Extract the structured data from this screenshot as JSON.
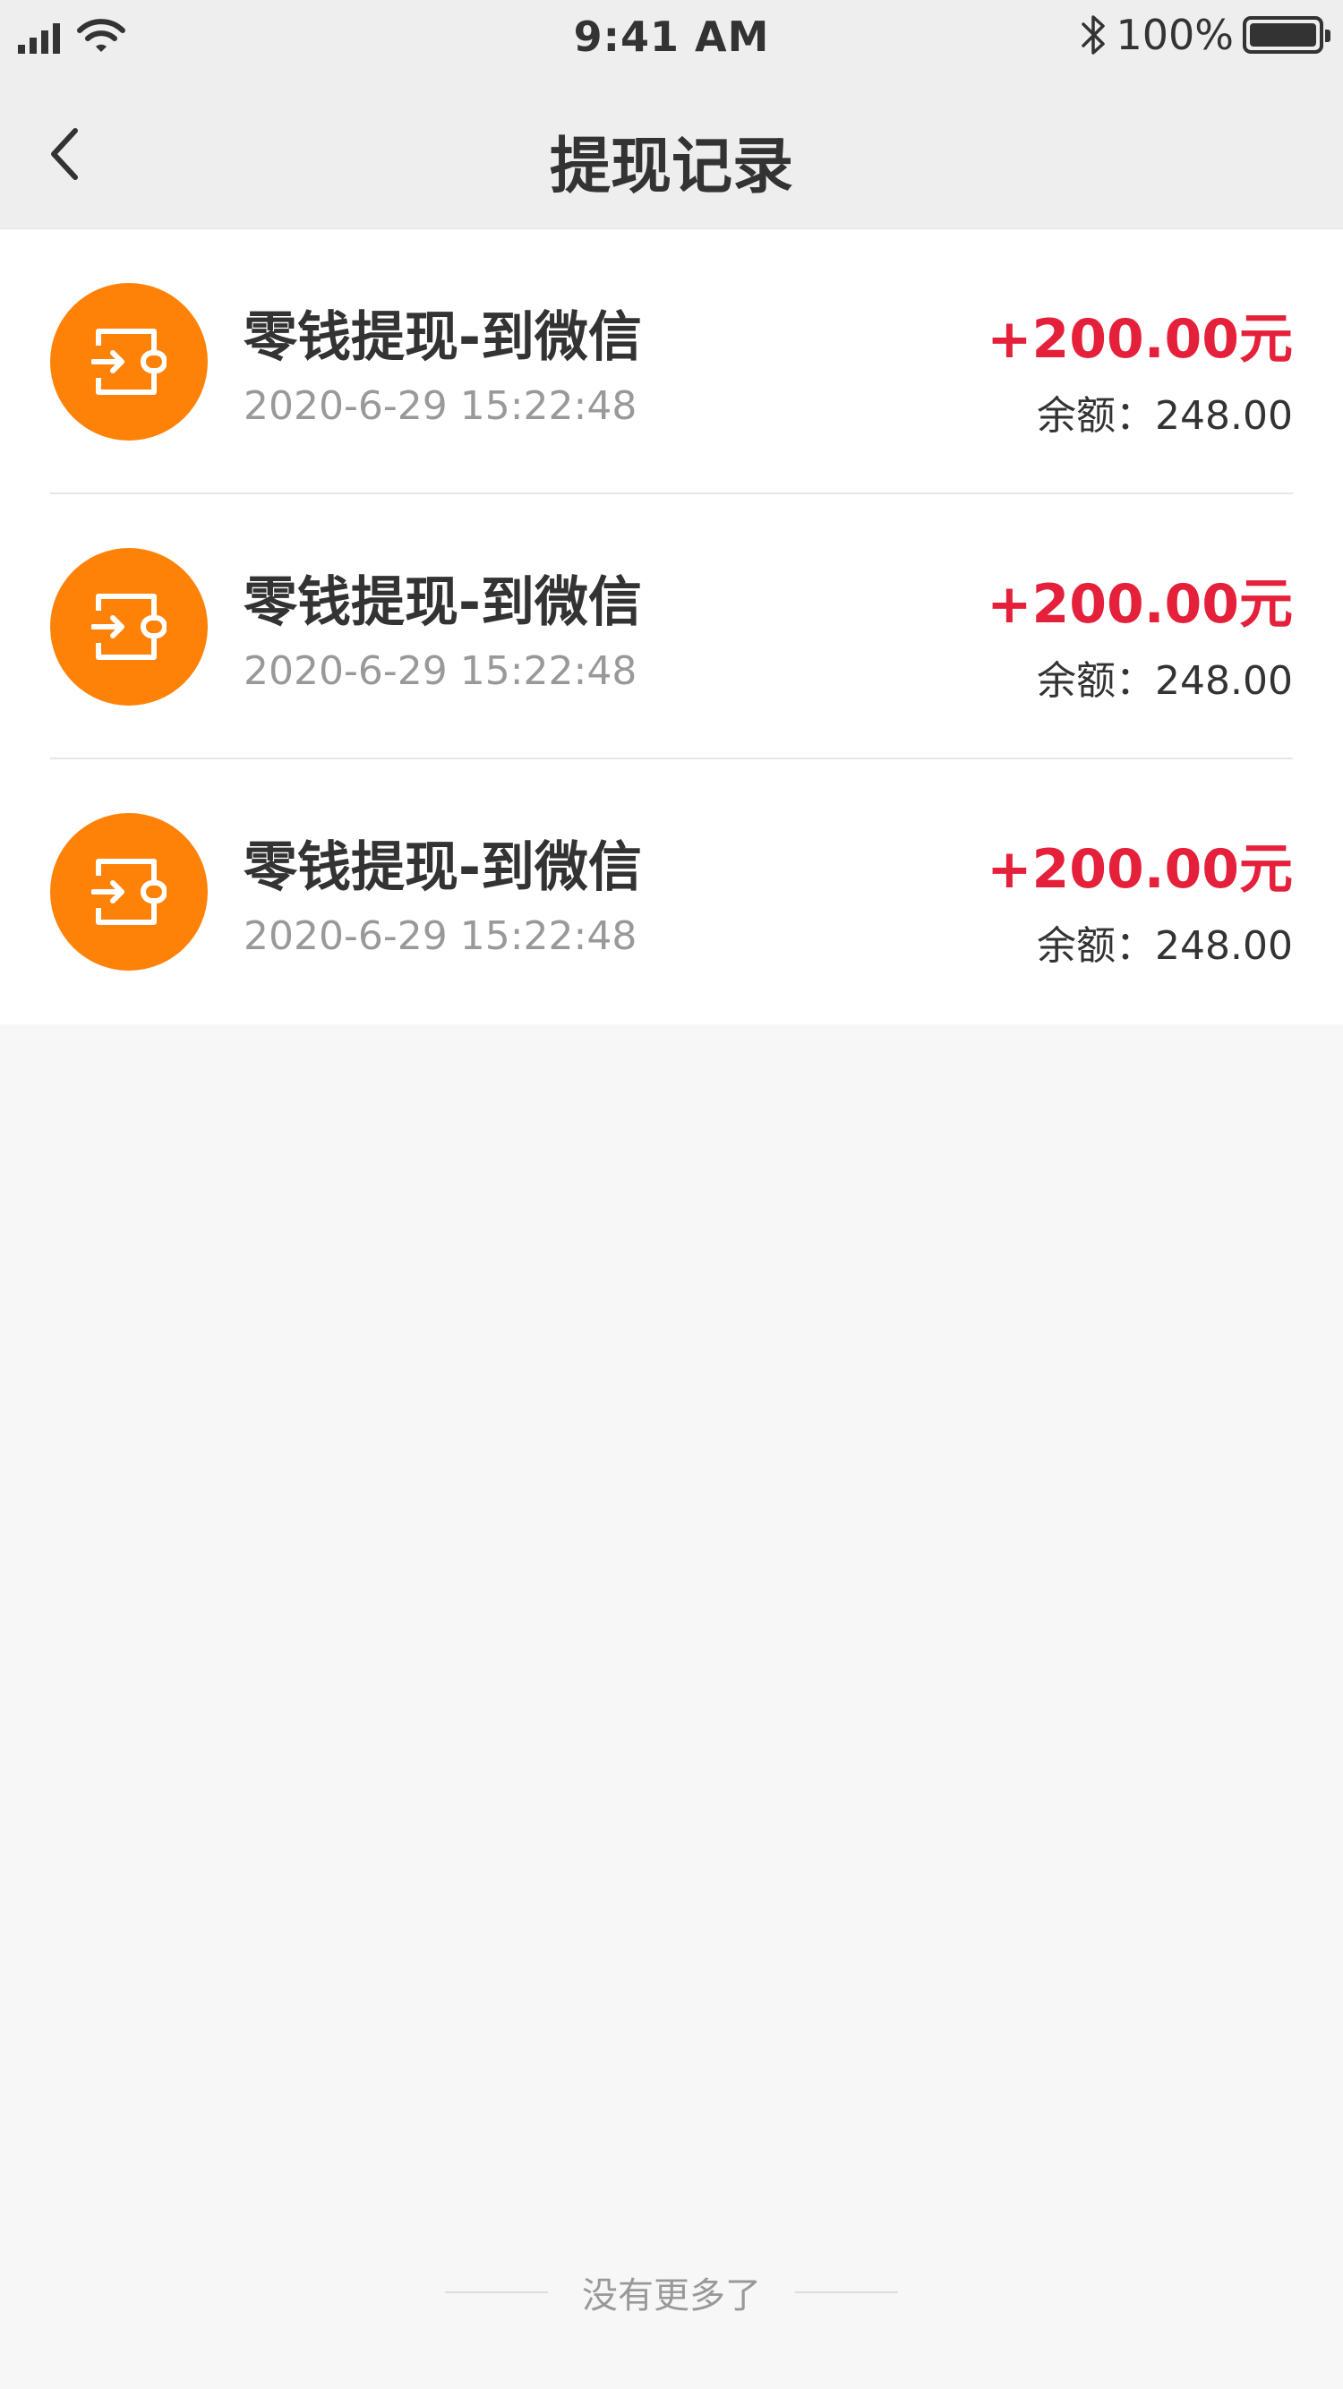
{
  "status_bar": {
    "time": "9:41 AM",
    "battery_text": "100%",
    "icons": [
      "signal-icon",
      "wifi-icon",
      "bluetooth-icon",
      "battery-icon"
    ]
  },
  "nav": {
    "title": "提现记录",
    "back_icon": "chevron-left-icon"
  },
  "records": [
    {
      "title": "零钱提现-到微信",
      "time": "2020-6-29 15:22:48",
      "amount": "+200.00元",
      "balance": "余额：248.00"
    },
    {
      "title": "零钱提现-到微信",
      "time": "2020-6-29 15:22:48",
      "amount": "+200.00元",
      "balance": "余额：248.00"
    },
    {
      "title": "零钱提现-到微信",
      "time": "2020-6-29 15:22:48",
      "amount": "+200.00元",
      "balance": "余额：248.00"
    }
  ],
  "footer": {
    "text": "没有更多了"
  },
  "colors": {
    "accent_orange": "#fe8208",
    "amount_red": "#e5203a",
    "background": "#f7f7f7",
    "header_background": "#eeeeee"
  }
}
